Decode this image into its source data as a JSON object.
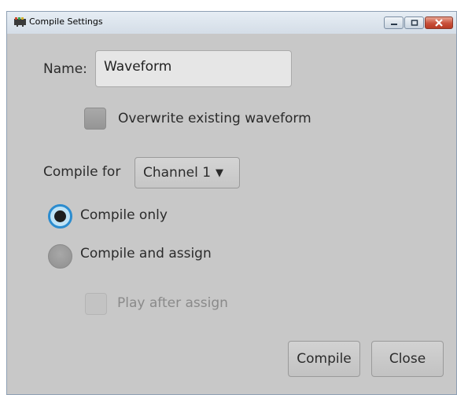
{
  "window": {
    "title": "Compile Settings",
    "controls": {
      "minimize": "minimize-icon",
      "maximize": "maximize-icon",
      "close": "close-icon"
    }
  },
  "form": {
    "name_label": "Name:",
    "name_value": "Waveform",
    "overwrite_label": "Overwrite existing waveform",
    "overwrite_checked": false,
    "compile_for_label": "Compile for",
    "channel_selected": "Channel 1",
    "options": [
      {
        "label": "Compile only",
        "selected": true
      },
      {
        "label": "Compile and assign",
        "selected": false
      }
    ],
    "play_after_label": "Play after assign",
    "play_after_checked": false,
    "play_after_enabled": false
  },
  "buttons": {
    "compile": "Compile",
    "close": "Close"
  },
  "colors": {
    "radio_accent": "#2b8ccf",
    "dialog_bg": "#c8c8c8"
  }
}
